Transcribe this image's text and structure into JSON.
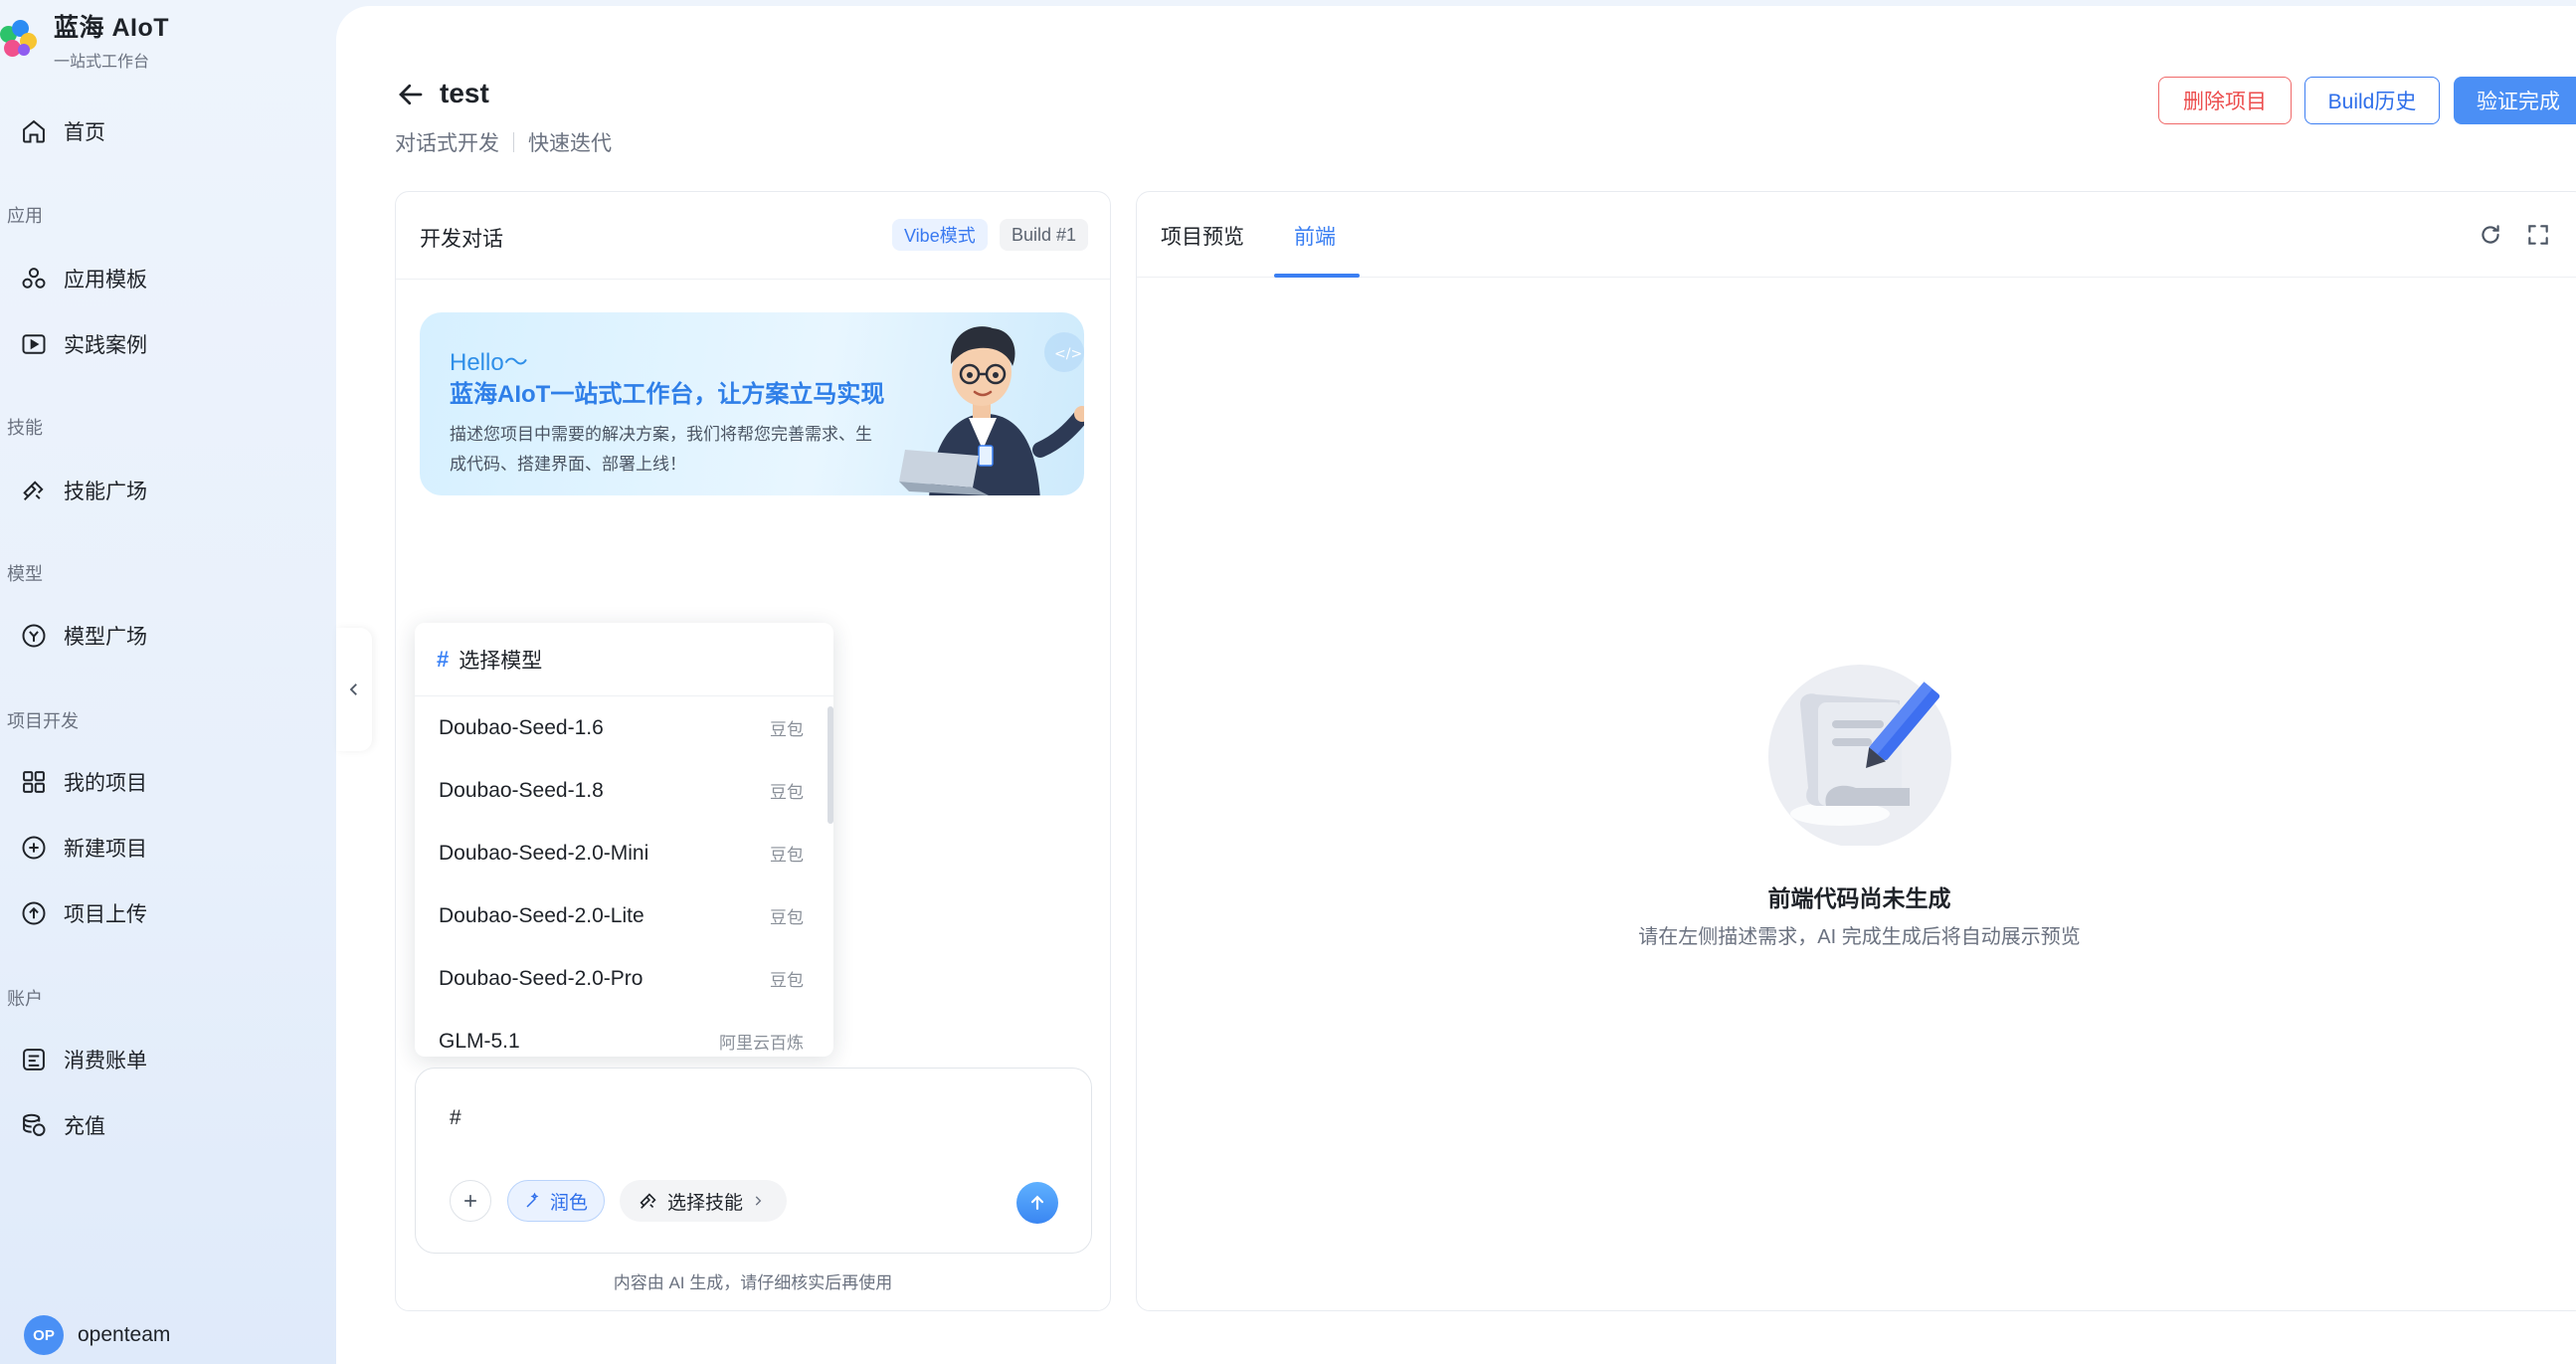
{
  "brand": {
    "name": "蓝海 AIoT",
    "subtitle": "一站式工作台"
  },
  "sidebar": {
    "home": "首页",
    "sections": {
      "app": "应用",
      "skill": "技能",
      "model": "模型",
      "project": "项目开发",
      "account": "账户"
    },
    "items": {
      "app_templates": "应用模板",
      "practice_cases": "实践案例",
      "skill_market": "技能广场",
      "model_market": "模型广场",
      "my_projects": "我的项目",
      "new_project": "新建项目",
      "upload_project": "项目上传",
      "billing": "消费账单",
      "recharge": "充值"
    },
    "user": {
      "initials": "OP",
      "name": "openteam"
    }
  },
  "header": {
    "title": "test",
    "subtitle_1": "对话式开发",
    "subtitle_2": "快速迭代",
    "delete_label": "删除项目",
    "history_label": "Build历史",
    "verify_label": "验证完成"
  },
  "chat": {
    "title": "开发对话",
    "mode_tag": "Vibe模式",
    "build_tag": "Build #1",
    "hello_line1": "Hello～",
    "hello_line2": "蓝海AIoT一站式工作台，让方案立马实现",
    "hello_desc": "描述您项目中需要的解决方案，我们将帮您完善需求、生成代码、搭建界面、部署上线！",
    "input_value": "#",
    "polish_label": "润色",
    "skill_label": "选择技能",
    "footnote": "内容由 AI 生成，请仔细核实后再使用"
  },
  "model_dropdown": {
    "title": "选择模型",
    "models": [
      {
        "name": "Doubao-Seed-1.6",
        "provider": "豆包"
      },
      {
        "name": "Doubao-Seed-1.8",
        "provider": "豆包"
      },
      {
        "name": "Doubao-Seed-2.0-Mini",
        "provider": "豆包"
      },
      {
        "name": "Doubao-Seed-2.0-Lite",
        "provider": "豆包"
      },
      {
        "name": "Doubao-Seed-2.0-Pro",
        "provider": "豆包"
      },
      {
        "name": "GLM-5.1",
        "provider": "阿里云百炼"
      }
    ]
  },
  "preview": {
    "tab_project": "项目预览",
    "tab_frontend": "前端",
    "empty_title": "前端代码尚未生成",
    "empty_sub": "请在左侧描述需求，AI 完成生成后将自动展示预览"
  },
  "colors": {
    "accent": "#3b7ff2",
    "danger": "#ec4d4d",
    "primary_button": "#4b8ff5"
  }
}
